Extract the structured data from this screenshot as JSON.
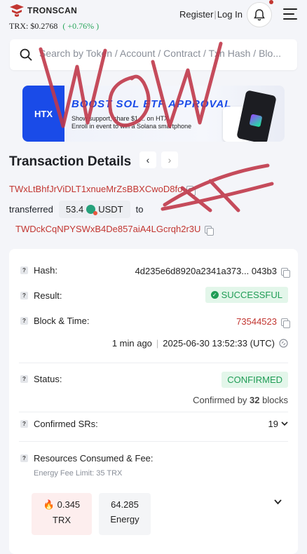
{
  "header": {
    "brand": "TRONSCAN",
    "trx_label": "TRX:",
    "trx_price": "$0.2768",
    "trx_change": "( +0.76% )",
    "register": "Register",
    "separator": "|",
    "login": "Log In"
  },
  "search": {
    "placeholder": "Search by Token / Account / Contract / Txn Hash / Blo..."
  },
  "banner": {
    "brand": "HTX",
    "headline": "BOOST SOL ETF APPROVAL",
    "sub1": "Show support, share $1,... on HTX",
    "sub2": "Enroll in event to win a Solana smartphone"
  },
  "transaction": {
    "title": "Transaction Details",
    "prev": "‹",
    "next": "›",
    "from": "TWxLtBhfJrViDLT1xnueMrZsBBXCwoD8fo",
    "transferred_label": "transferred",
    "amount": "53.4",
    "token": "USDT",
    "to_label": "to",
    "to": "TWDckCqNPYSWxB4De857aiA4LGcrqh2r3U"
  },
  "details": {
    "hash_label": "Hash:",
    "hash_value": "4d235e6d8920a2341a373... 043b3",
    "result_label": "Result:",
    "result_value": "SUCCESSFUL",
    "block_label": "Block & Time:",
    "block_value": "73544523",
    "time_ago": "1 min ago",
    "time_sep": "|",
    "timestamp": "2025-06-30 13:52:33 (UTC)",
    "status_label": "Status:",
    "status_value": "CONFIRMED",
    "confirmed_by_prefix": "Confirmed by",
    "confirmed_by_count": "32",
    "confirmed_by_suffix": "blocks",
    "srs_label": "Confirmed SRs:",
    "srs_value": "19",
    "resources_label": "Resources Consumed & Fee:",
    "energy_limit": "Energy Fee Limit: 35 TRX",
    "fee_trx_value": "0.345",
    "fee_trx_unit": "TRX",
    "energy_value": "64.285",
    "energy_unit": "Energy"
  },
  "colors": {
    "accent_red": "#c23631",
    "success_green": "#1f9c55",
    "scribble": "#c0394a"
  },
  "icons": [
    "tronscan-logo-icon",
    "bell-icon",
    "menu-icon",
    "search-icon",
    "copy-icon",
    "usdt-icon",
    "check-icon",
    "help-icon",
    "clock-icon",
    "chevron-down-icon",
    "flame-icon"
  ]
}
